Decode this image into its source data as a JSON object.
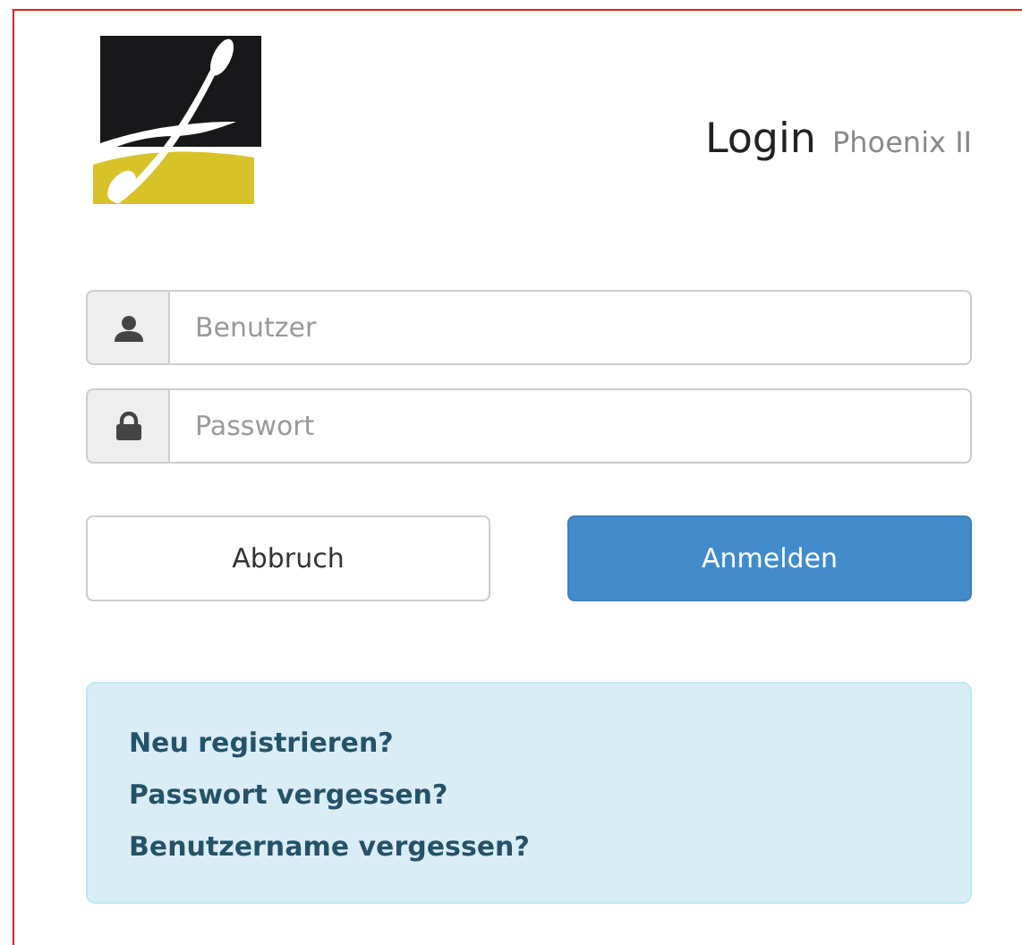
{
  "header": {
    "title": "Login",
    "subtitle": "Phoenix II"
  },
  "fields": [
    {
      "kind": "user",
      "placeholder": "Benutzer"
    },
    {
      "kind": "lock",
      "placeholder": "Passwort"
    }
  ],
  "buttons": [
    {
      "kind": "default",
      "label": "Abbruch"
    },
    {
      "kind": "primary",
      "label": "Anmelden"
    }
  ],
  "links": [
    "Neu registrieren?",
    "Passwort vergessen?",
    "Benutzername vergessen?"
  ]
}
